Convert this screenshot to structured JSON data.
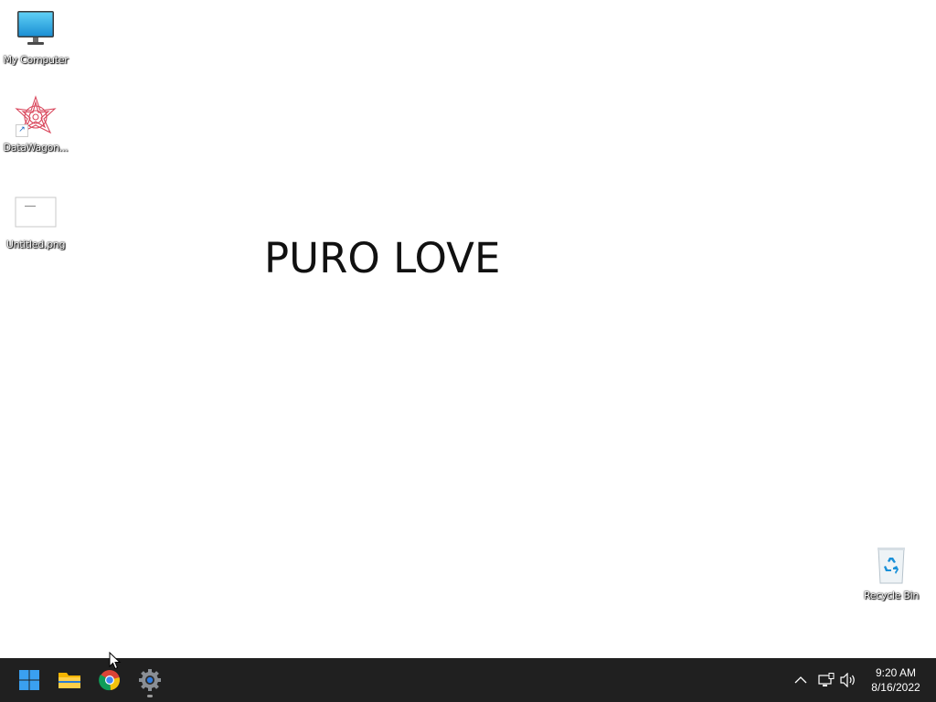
{
  "desktop": {
    "background": "#ffffff",
    "headline": "PURO LOVE",
    "icons": [
      {
        "label": "My Computer",
        "icon": "monitor-icon"
      },
      {
        "label": "DataWagon...",
        "icon": "datawagon-app-icon"
      },
      {
        "label": "Untitled.png",
        "icon": "image-thumbnail-icon"
      },
      {
        "label": "Recycle Bin",
        "icon": "recycle-bin-icon"
      }
    ]
  },
  "taskbar": {
    "background": "#202020",
    "apps": [
      {
        "name": "Start",
        "icon": "windows-start-icon"
      },
      {
        "name": "File Explorer",
        "icon": "folder-icon"
      },
      {
        "name": "Google Chrome",
        "icon": "chrome-icon"
      },
      {
        "name": "Settings",
        "icon": "gear-icon",
        "running": true
      }
    ],
    "tray": {
      "icons": [
        "chevron-up-icon",
        "network-icon",
        "volume-icon"
      ],
      "time": "9:20 AM",
      "date": "8/16/2022"
    }
  }
}
